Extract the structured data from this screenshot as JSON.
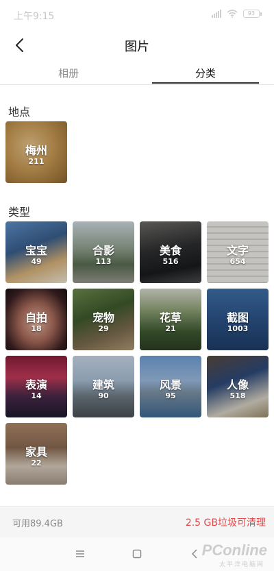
{
  "status_bar": {
    "time": "上午9:15",
    "battery": "93"
  },
  "header": {
    "title": "图片"
  },
  "tabs": [
    {
      "label": "相册",
      "active": false
    },
    {
      "label": "分类",
      "active": true
    }
  ],
  "sections": {
    "places": {
      "title": "地点",
      "items": [
        {
          "name": "梅州",
          "count": "211"
        }
      ]
    },
    "types": {
      "title": "类型",
      "items": [
        {
          "name": "宝宝",
          "count": "49"
        },
        {
          "name": "合影",
          "count": "113"
        },
        {
          "name": "美食",
          "count": "516"
        },
        {
          "name": "文字",
          "count": "654"
        },
        {
          "name": "自拍",
          "count": "18"
        },
        {
          "name": "宠物",
          "count": "29"
        },
        {
          "name": "花草",
          "count": "21"
        },
        {
          "name": "截图",
          "count": "1003"
        },
        {
          "name": "表演",
          "count": "14"
        },
        {
          "name": "建筑",
          "count": "90"
        },
        {
          "name": "风景",
          "count": "95"
        },
        {
          "name": "人像",
          "count": "518"
        },
        {
          "name": "家具",
          "count": "22"
        }
      ]
    }
  },
  "storage": {
    "available": "可用89.4GB",
    "cleanable": "2.5 GB垃圾可清理"
  },
  "watermark": {
    "brand": "PConline",
    "sub": "太平洋电脑网"
  },
  "colors": {
    "accent_red": "#e04848",
    "tab_indicator": "#333333"
  },
  "icons": {
    "back": "back-arrow-icon",
    "signal": "signal-icon",
    "wifi": "wifi-icon",
    "battery": "battery-icon",
    "menu": "menu-icon",
    "home": "home-icon",
    "nav_back": "nav-back-icon"
  }
}
